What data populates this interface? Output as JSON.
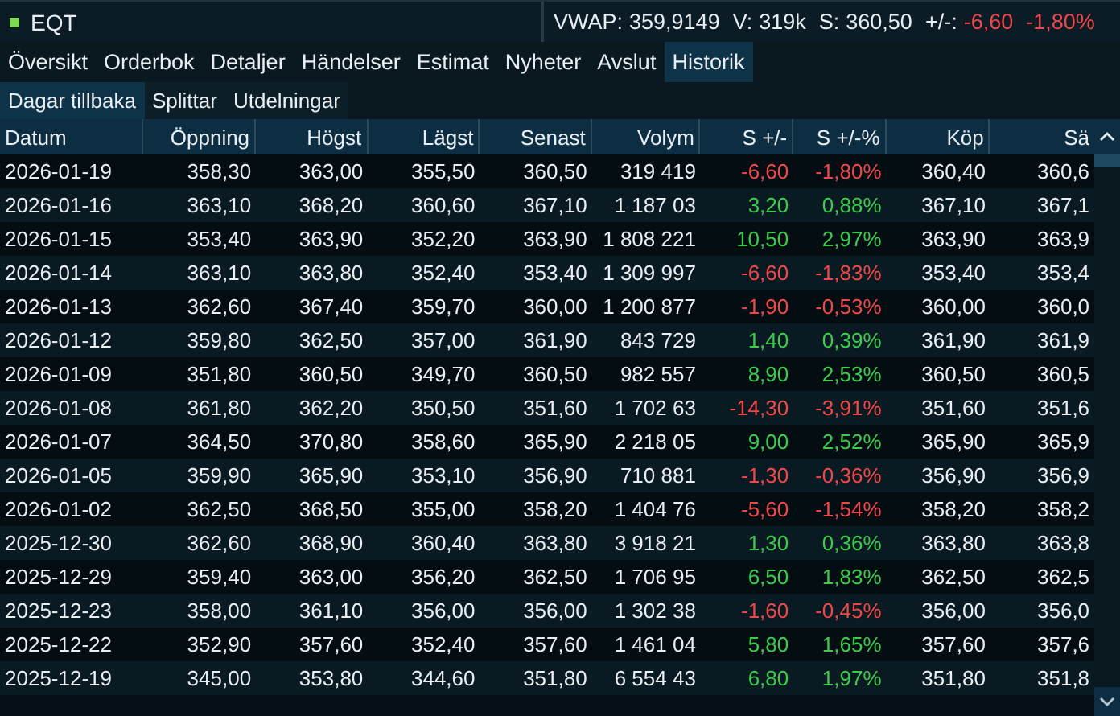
{
  "title": {
    "symbol": "EQT"
  },
  "quote": {
    "vwap_label": "VWAP:",
    "vwap": "359,9149",
    "volume_label": "V:",
    "volume": "319k",
    "last_label": "S:",
    "last": "360,50",
    "change_label": "+/-:",
    "change": "-6,60",
    "change_pct": "-1,80%",
    "color": "#f04848"
  },
  "tabs": [
    {
      "label": "Översikt",
      "selected": false
    },
    {
      "label": "Orderbok",
      "selected": false
    },
    {
      "label": "Detaljer",
      "selected": false
    },
    {
      "label": "Händelser",
      "selected": false
    },
    {
      "label": "Estimat",
      "selected": false
    },
    {
      "label": "Nyheter",
      "selected": false
    },
    {
      "label": "Avslut",
      "selected": false
    },
    {
      "label": "Historik",
      "selected": true
    }
  ],
  "subtabs": [
    {
      "label": "Dagar tillbaka",
      "selected": true
    },
    {
      "label": "Splittar",
      "selected": false
    },
    {
      "label": "Utdelningar",
      "selected": false
    }
  ],
  "table": {
    "columns": [
      "Datum",
      "Öppning",
      "Högst",
      "Lägst",
      "Senast",
      "Volym",
      "S +/-",
      "S +/-%",
      "Köp",
      "Sä"
    ],
    "rows": [
      {
        "cells": [
          "2026-01-19",
          "358,30",
          "363,00",
          "355,50",
          "360,50",
          "319 419",
          "-6,60",
          "-1,80%",
          "360,40",
          "360,6"
        ],
        "color": "#f04848"
      },
      {
        "cells": [
          "2026-01-16",
          "363,10",
          "368,20",
          "360,60",
          "367,10",
          "1 187 03",
          "3,20",
          "0,88%",
          "367,10",
          "367,1"
        ],
        "color": "#3ccc4c"
      },
      {
        "cells": [
          "2026-01-15",
          "353,40",
          "363,90",
          "352,20",
          "363,90",
          "1 808 221",
          "10,50",
          "2,97%",
          "363,90",
          "363,9"
        ],
        "color": "#3ccc4c"
      },
      {
        "cells": [
          "2026-01-14",
          "363,10",
          "363,80",
          "352,40",
          "353,40",
          "1 309 997",
          "-6,60",
          "-1,83%",
          "353,40",
          "353,4"
        ],
        "color": "#f04848"
      },
      {
        "cells": [
          "2026-01-13",
          "362,60",
          "367,40",
          "359,70",
          "360,00",
          "1 200 877",
          "-1,90",
          "-0,53%",
          "360,00",
          "360,0"
        ],
        "color": "#f04848"
      },
      {
        "cells": [
          "2026-01-12",
          "359,80",
          "362,50",
          "357,00",
          "361,90",
          "843 729",
          "1,40",
          "0,39%",
          "361,90",
          "361,9"
        ],
        "color": "#3ccc4c"
      },
      {
        "cells": [
          "2026-01-09",
          "351,80",
          "360,50",
          "349,70",
          "360,50",
          "982 557",
          "8,90",
          "2,53%",
          "360,50",
          "360,5"
        ],
        "color": "#3ccc4c"
      },
      {
        "cells": [
          "2026-01-08",
          "361,80",
          "362,20",
          "350,50",
          "351,60",
          "1 702 63",
          "-14,30",
          "-3,91%",
          "351,60",
          "351,6"
        ],
        "color": "#f04848"
      },
      {
        "cells": [
          "2026-01-07",
          "364,50",
          "370,80",
          "358,60",
          "365,90",
          "2 218 05",
          "9,00",
          "2,52%",
          "365,90",
          "365,9"
        ],
        "color": "#3ccc4c"
      },
      {
        "cells": [
          "2026-01-05",
          "359,90",
          "365,90",
          "353,10",
          "356,90",
          "710 881",
          "-1,30",
          "-0,36%",
          "356,90",
          "356,9"
        ],
        "color": "#f04848"
      },
      {
        "cells": [
          "2026-01-02",
          "362,50",
          "368,50",
          "355,00",
          "358,20",
          "1 404 76",
          "-5,60",
          "-1,54%",
          "358,20",
          "358,2"
        ],
        "color": "#f04848"
      },
      {
        "cells": [
          "2025-12-30",
          "362,60",
          "368,90",
          "360,40",
          "363,80",
          "3 918 21",
          "1,30",
          "0,36%",
          "363,80",
          "363,8"
        ],
        "color": "#3ccc4c"
      },
      {
        "cells": [
          "2025-12-29",
          "359,40",
          "363,00",
          "356,20",
          "362,50",
          "1 706 95",
          "6,50",
          "1,83%",
          "362,50",
          "362,5"
        ],
        "color": "#3ccc4c"
      },
      {
        "cells": [
          "2025-12-23",
          "358,00",
          "361,10",
          "356,00",
          "356,00",
          "1 302 38",
          "-1,60",
          "-0,45%",
          "356,00",
          "356,0"
        ],
        "color": "#f04848"
      },
      {
        "cells": [
          "2025-12-22",
          "352,90",
          "357,60",
          "352,40",
          "357,60",
          "1 461 04",
          "5,80",
          "1,65%",
          "357,60",
          "357,6"
        ],
        "color": "#3ccc4c"
      },
      {
        "cells": [
          "2025-12-19",
          "345,00",
          "353,80",
          "344,60",
          "351,80",
          "6 554 43",
          "6,80",
          "1,97%",
          "351,80",
          "351,8"
        ],
        "color": "#3ccc4c"
      }
    ]
  }
}
